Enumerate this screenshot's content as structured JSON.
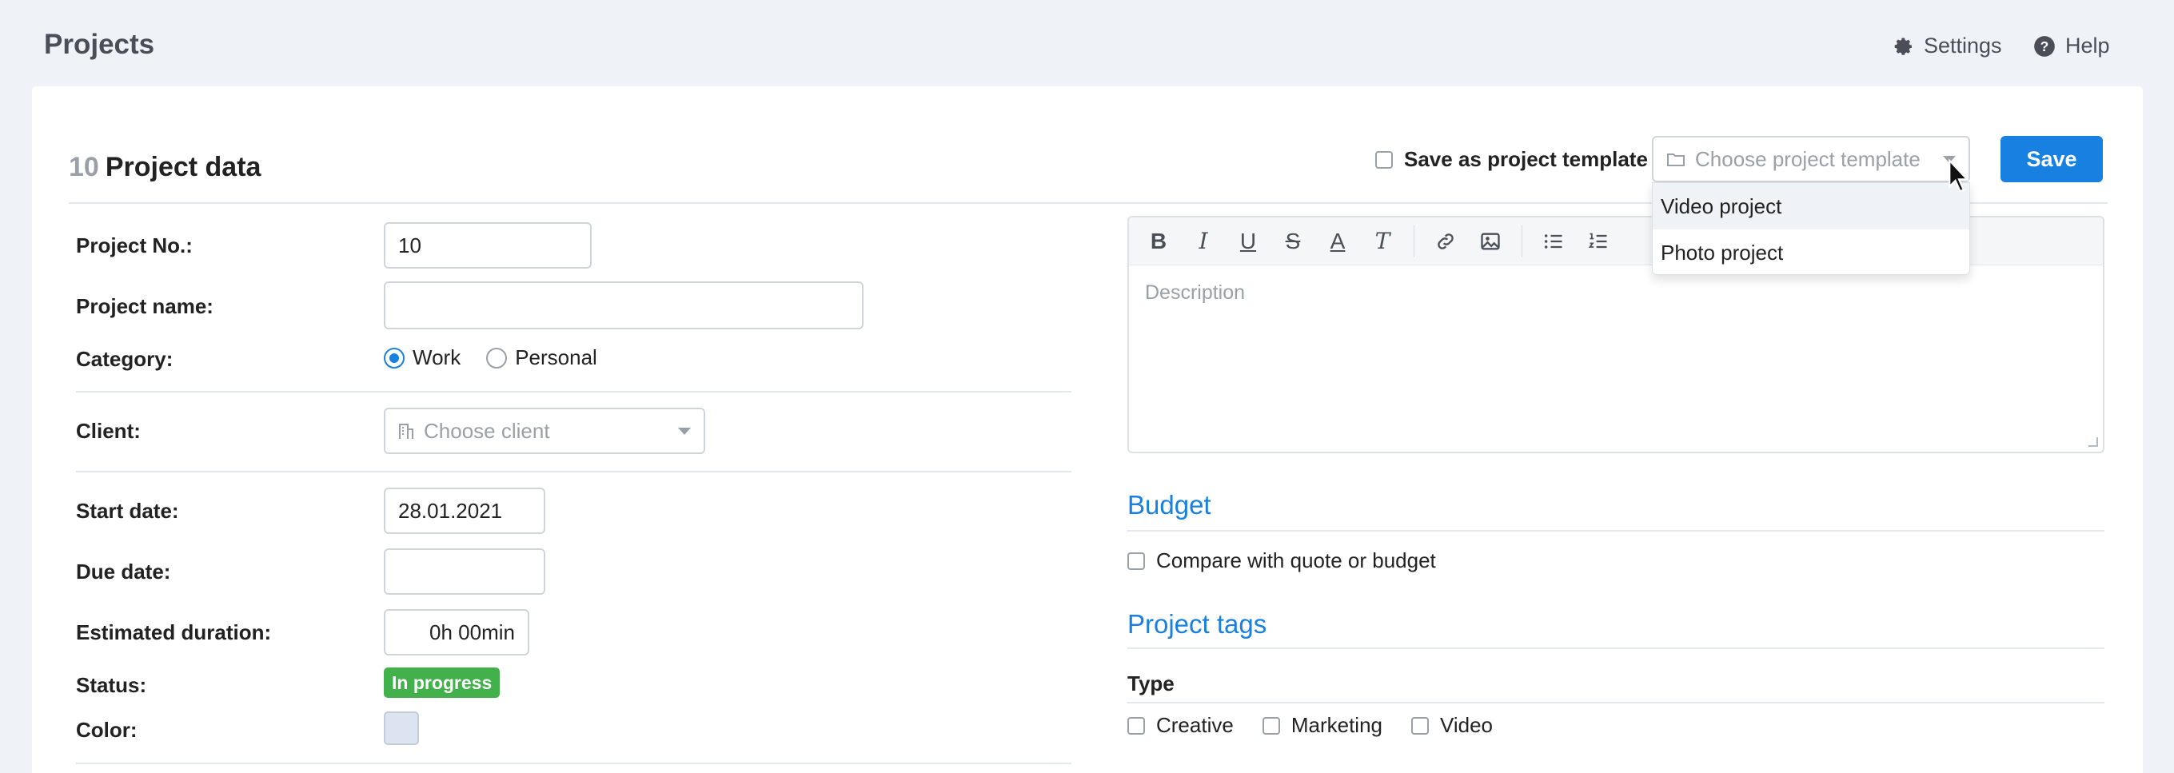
{
  "app": {
    "title": "Projects"
  },
  "nav": {
    "settings": "Settings",
    "help": "Help"
  },
  "header": {
    "project_number": "10",
    "title": "Project data",
    "save_as_template_label": "Save as project template",
    "template_placeholder": "Choose project template",
    "template_options": [
      "Video project",
      "Photo project"
    ],
    "save_label": "Save"
  },
  "form": {
    "project_no_label": "Project No.:",
    "project_no_value": "10",
    "project_name_label": "Project name:",
    "project_name_value": "",
    "category_label": "Category:",
    "category_options": [
      "Work",
      "Personal"
    ],
    "category_selected": "Work",
    "client_label": "Client:",
    "client_placeholder": "Choose client",
    "start_date_label": "Start date:",
    "start_date_value": "28.01.2021",
    "due_date_label": "Due date:",
    "due_date_value": "",
    "estimated_duration_label": "Estimated duration:",
    "estimated_duration_value": "0h 00min",
    "status_label": "Status:",
    "status_value": "In progress",
    "status_color": "#43b14b",
    "color_label": "Color:",
    "color_value": "#dbe4f0"
  },
  "editor": {
    "placeholder": "Description",
    "tools": [
      "bold-icon",
      "italic-icon",
      "underline-icon",
      "strikethrough-icon",
      "text-color-icon",
      "clear-format-icon",
      "link-icon",
      "image-icon",
      "bulleted-list-icon",
      "numbered-list-icon"
    ]
  },
  "budget": {
    "heading": "Budget",
    "compare_label": "Compare with quote or budget"
  },
  "tags": {
    "heading": "Project tags",
    "type_label": "Type",
    "type_options": [
      "Creative",
      "Marketing",
      "Video"
    ]
  },
  "colors": {
    "accent": "#1880e0",
    "background": "#eff2f7"
  }
}
